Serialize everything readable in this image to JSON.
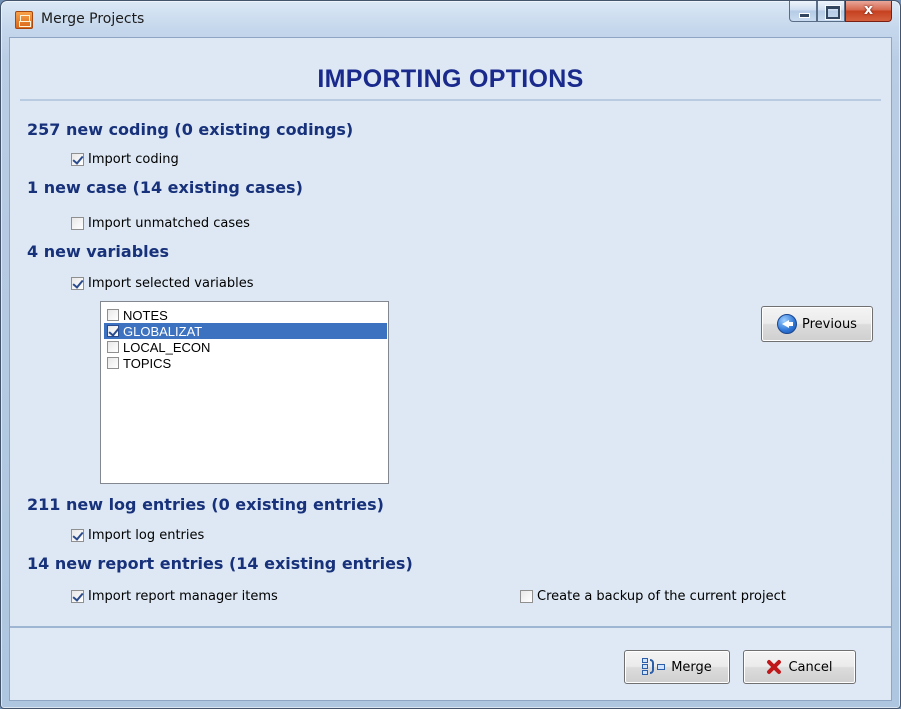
{
  "window": {
    "title": "Merge Projects",
    "close_glyph": "x"
  },
  "heading": "IMPORTING OPTIONS",
  "sections": {
    "coding": {
      "title": "257 new coding (0 existing codings)",
      "option_label": "Import coding",
      "checked": true
    },
    "cases": {
      "title": "1 new case (14 existing cases)",
      "option_label": "Import unmatched cases",
      "checked": false
    },
    "variables": {
      "title": "4 new variables",
      "option_label": "Import selected variables",
      "checked": true,
      "items": [
        {
          "label": "NOTES",
          "checked": false,
          "selected": false
        },
        {
          "label": "GLOBALIZAT",
          "checked": true,
          "selected": true
        },
        {
          "label": "LOCAL_ECON",
          "checked": false,
          "selected": false
        },
        {
          "label": "TOPICS",
          "checked": false,
          "selected": false
        }
      ]
    },
    "log": {
      "title": "211 new log entries (0 existing entries)",
      "option_label": "Import log entries",
      "checked": true
    },
    "report": {
      "title": "14 new report entries (14 existing entries)",
      "option_label": "Import report manager items",
      "checked": true
    }
  },
  "backup": {
    "label": "Create a backup of the current project",
    "checked": false
  },
  "buttons": {
    "previous": "Previous",
    "merge": "Merge",
    "cancel": "Cancel"
  },
  "colors": {
    "heading": "#1a2a8c",
    "section_title": "#17317a",
    "selection": "#3d72c0"
  },
  "icons": {
    "app": "merge-projects-app-icon",
    "previous": "left-arrow-circle-icon",
    "merge": "merge-icon",
    "cancel": "red-x-icon"
  }
}
